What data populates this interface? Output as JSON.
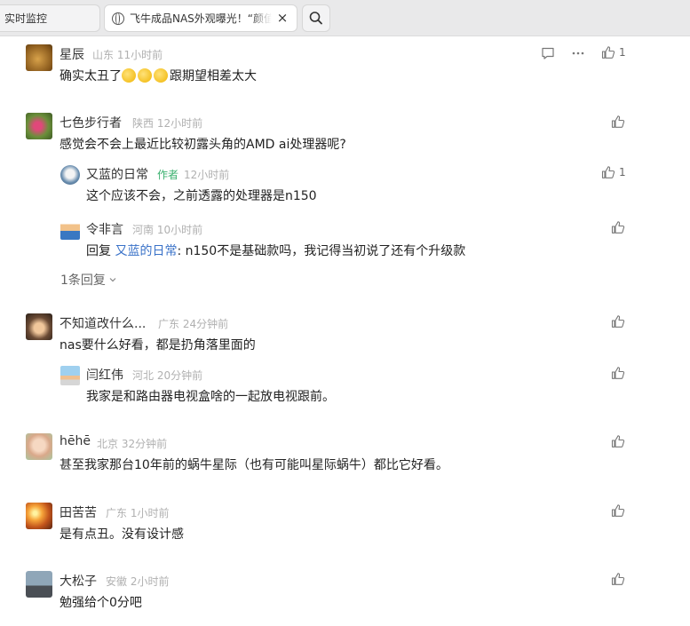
{
  "tabs": [
    {
      "label": "实时监控"
    },
    {
      "label": "飞牛成品NAS外观曝光！“颜值"
    }
  ],
  "tab_close_symbol": "×",
  "comments": [
    {
      "name": "星辰",
      "location": "山东",
      "time": "11小时前",
      "text": "确实太丑了",
      "text_tail": "跟期望相差太大",
      "emoji_count": 3,
      "likes": "1"
    },
    {
      "name": "七色步行者",
      "location": "陕西",
      "time": "12小时前",
      "text": "感觉会不会上最近比较初露头角的AMD ai处理器呢?",
      "likes": ""
    },
    {
      "name": "又蓝的日常",
      "badge": "作者",
      "time": "12小时前",
      "text": "这个应该不会，之前透露的处理器是n150",
      "likes": "1"
    },
    {
      "name": "令非言",
      "location": "河南",
      "time": "10小时前",
      "reply_prefix": "回复 ",
      "reply_to": "又蓝的日常",
      "text": ": n150不是基础款吗，我记得当初说了还有个升级款",
      "likes": ""
    },
    {
      "name": "不知道改什么...",
      "location": "广东",
      "time": "24分钟前",
      "text": "nas要什么好看，都是扔角落里面的",
      "likes": ""
    },
    {
      "name": "闫红伟",
      "location": "河北",
      "time": "20分钟前",
      "text": "我家是和路由器电视盒啥的一起放电视跟前。",
      "likes": ""
    },
    {
      "name": "hēhē",
      "location": "北京",
      "time": "32分钟前",
      "text": "甚至我家那台10年前的蜗牛星际（也有可能叫星际蜗牛）都比它好看。",
      "likes": ""
    },
    {
      "name": "田苦苦",
      "location": "广东",
      "time": "1小时前",
      "text": "是有点丑。没有设计感",
      "likes": ""
    },
    {
      "name": "大松子",
      "location": "安徽",
      "time": "2小时前",
      "text": "勉强给个0分吧",
      "likes": ""
    }
  ],
  "expand_replies": "1条回复",
  "colors": {
    "accent_link": "#3a72c8",
    "author_badge": "#3bb16f",
    "meta": "#b0b0b0"
  }
}
